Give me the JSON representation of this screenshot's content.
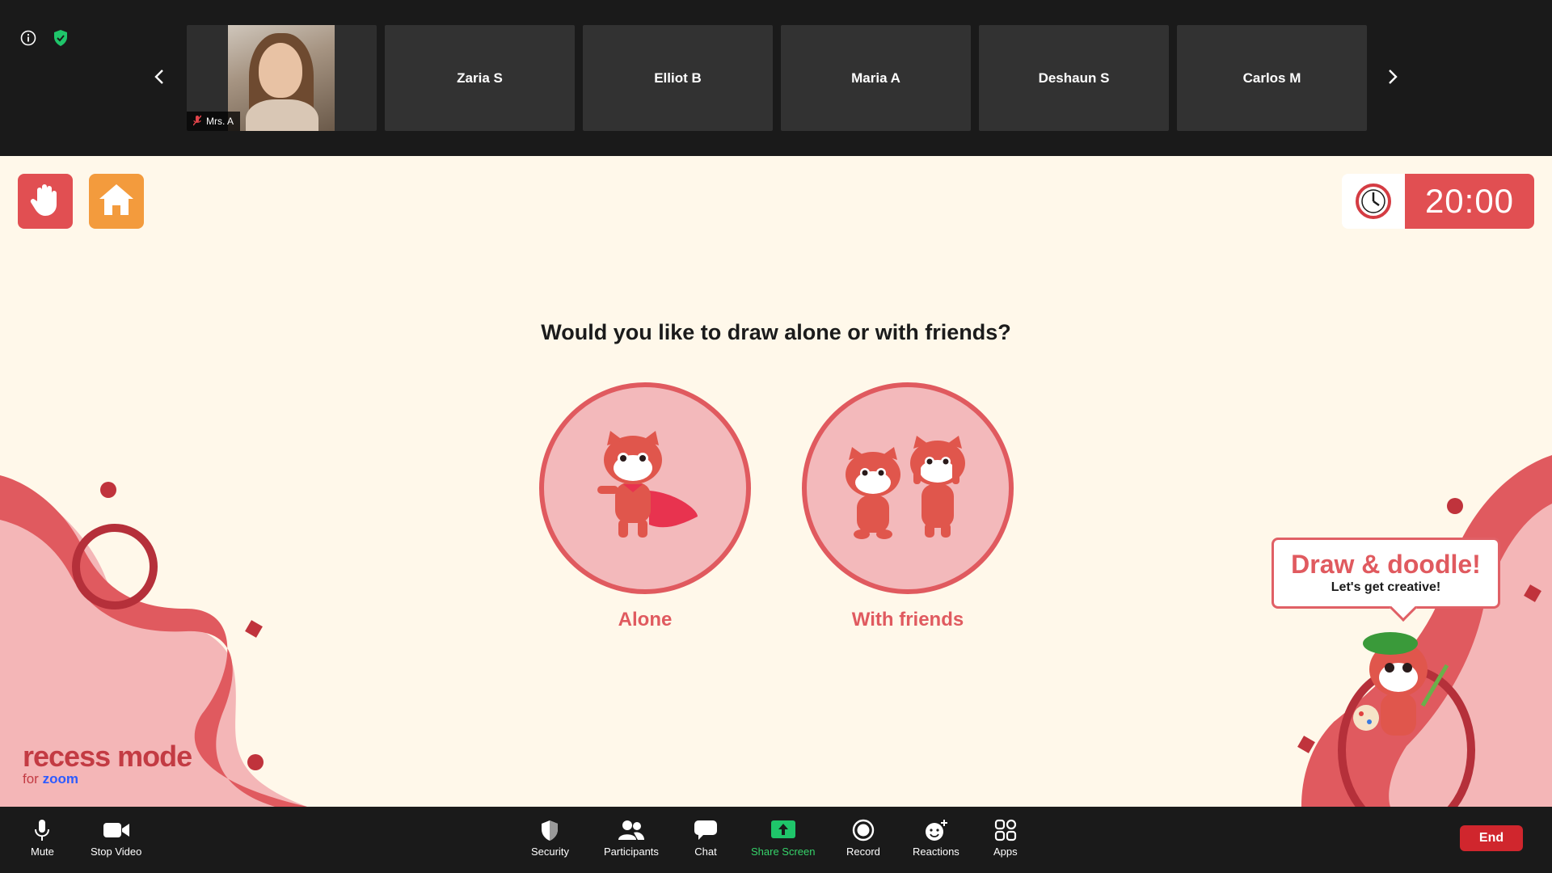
{
  "gallery": {
    "self": {
      "name": "Mrs. A"
    },
    "tiles": [
      {
        "name": "Zaria S"
      },
      {
        "name": "Elliot B"
      },
      {
        "name": "Maria A"
      },
      {
        "name": "Deshaun S"
      },
      {
        "name": "Carlos M"
      }
    ]
  },
  "timer": {
    "value": "20:00"
  },
  "activity": {
    "question": "Would you like to draw alone or with friends?",
    "options": [
      {
        "label": "Alone"
      },
      {
        "label": "With friends"
      }
    ]
  },
  "brand": {
    "main": "recess mode",
    "sub_prefix": "for",
    "sub_brand": "zoom"
  },
  "bubble": {
    "title": "Draw & doodle!",
    "subtitle": "Let's get creative!"
  },
  "toolbar": {
    "mute": "Mute",
    "stop_video": "Stop Video",
    "security": "Security",
    "participants": "Participants",
    "chat": "Chat",
    "share_screen": "Share Screen",
    "record": "Record",
    "reactions": "Reactions",
    "apps": "Apps",
    "end": "End"
  },
  "colors": {
    "accent_red": "#e14f52",
    "home_orange": "#f39b3d",
    "stage_bg": "#fff8ea",
    "share_green": "#36d36a",
    "end_red": "#d0262d"
  },
  "icons": [
    "info-icon",
    "shield-check-icon",
    "chevron-left-icon",
    "chevron-right-icon",
    "raise-hand-icon",
    "home-icon",
    "clock-icon",
    "mic-icon",
    "video-icon",
    "security-icon",
    "participants-icon",
    "chat-icon",
    "share-screen-icon",
    "record-icon",
    "reactions-icon",
    "apps-icon"
  ]
}
